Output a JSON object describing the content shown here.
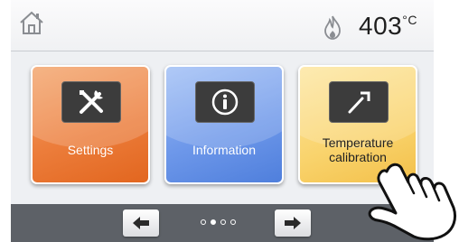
{
  "header": {
    "home_icon": "home-icon",
    "heating_icon": "flame-icon",
    "temperature_value": "403",
    "temperature_unit": "°C"
  },
  "tiles": [
    {
      "label": "Settings",
      "icon": "tools-icon",
      "color": "#ec7d3b"
    },
    {
      "label": "Information",
      "icon": "info-icon",
      "color": "#6e98ea"
    },
    {
      "label": "Temperature calibration",
      "icon": "probe-icon",
      "color": "#f9d36c"
    }
  ],
  "footer": {
    "prev_icon": "arrow-left-icon",
    "next_icon": "arrow-right-icon",
    "page_count": 4,
    "active_page": 2
  },
  "overlay": {
    "icon": "pointing-hand-icon"
  }
}
